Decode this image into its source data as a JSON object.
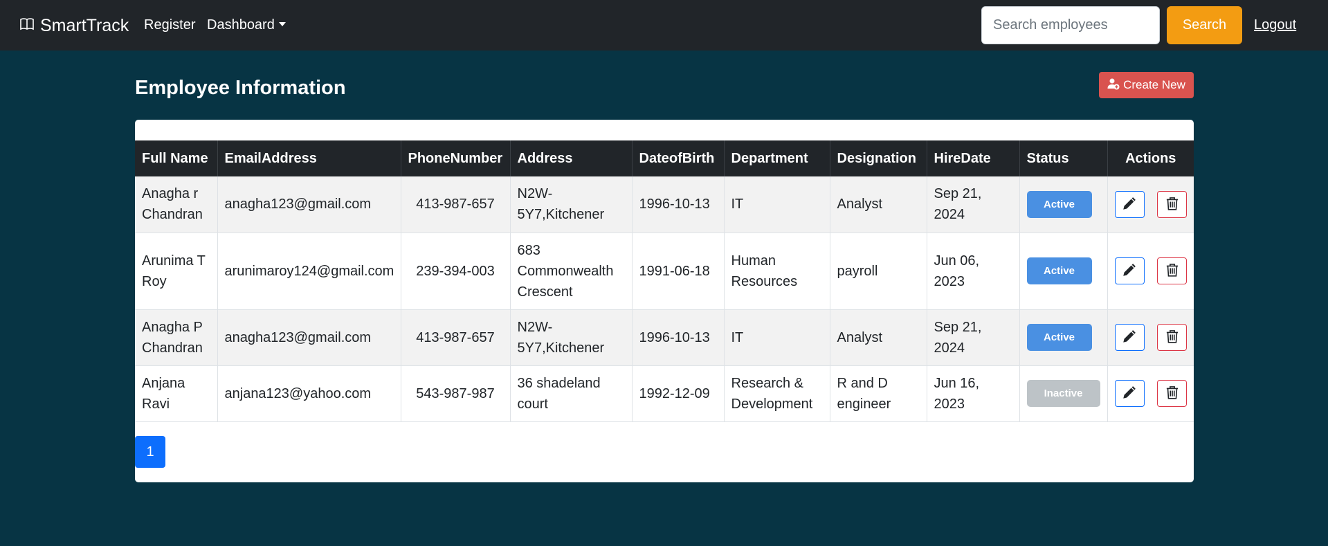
{
  "navbar": {
    "brand": "SmartTrack",
    "links": [
      "Register",
      "Dashboard"
    ],
    "search_placeholder": "Search employees",
    "search_label": "Search",
    "logout_label": "Logout"
  },
  "page": {
    "title": "Employee Information",
    "create_label": "Create New"
  },
  "table": {
    "headers": [
      "Full Name",
      "EmailAddress",
      "PhoneNumber",
      "Address",
      "DateofBirth",
      "Department",
      "Designation",
      "HireDate",
      "Status",
      "Actions"
    ],
    "rows": [
      {
        "full_name": "Anagha r Chandran",
        "email": "anagha123@gmail.com",
        "phone": "413-987-657",
        "address": "N2W-5Y7,Kitchener",
        "dob": "1996-10-13",
        "department": "IT",
        "designation": "Analyst",
        "hire_date": "Sep 21, 2024",
        "status": "Active"
      },
      {
        "full_name": "Arunima T Roy",
        "email": "arunimaroy124@gmail.com",
        "phone": "239-394-003",
        "address": "683 Commonwealth Crescent",
        "dob": "1991-06-18",
        "department": "Human Resources",
        "designation": "payroll",
        "hire_date": "Jun 06, 2023",
        "status": "Active"
      },
      {
        "full_name": "Anagha P Chandran",
        "email": "anagha123@gmail.com",
        "phone": "413-987-657",
        "address": "N2W-5Y7,Kitchener",
        "dob": "1996-10-13",
        "department": "IT",
        "designation": "Analyst",
        "hire_date": "Sep 21, 2024",
        "status": "Active"
      },
      {
        "full_name": "Anjana Ravi",
        "email": "anjana123@yahoo.com",
        "phone": "543-987-987",
        "address": "36 shadeland court",
        "dob": "1992-12-09",
        "department": "Research & Development",
        "designation": "R and D engineer",
        "hire_date": "Jun 16, 2023",
        "status": "Inactive"
      }
    ]
  },
  "pagination": {
    "current_page": "1"
  },
  "icons": {
    "brand": "book-icon",
    "create": "person-plus-icon",
    "edit": "pencil-icon",
    "delete": "trash-icon"
  },
  "colors": {
    "page_bg": "#073444",
    "navbar_bg": "#212529",
    "search_button": "#f39c12",
    "create_button": "#d9534f",
    "active_badge": "#4a90e2",
    "inactive_badge": "#bdc3c7",
    "page_button": "#0d6efd"
  }
}
